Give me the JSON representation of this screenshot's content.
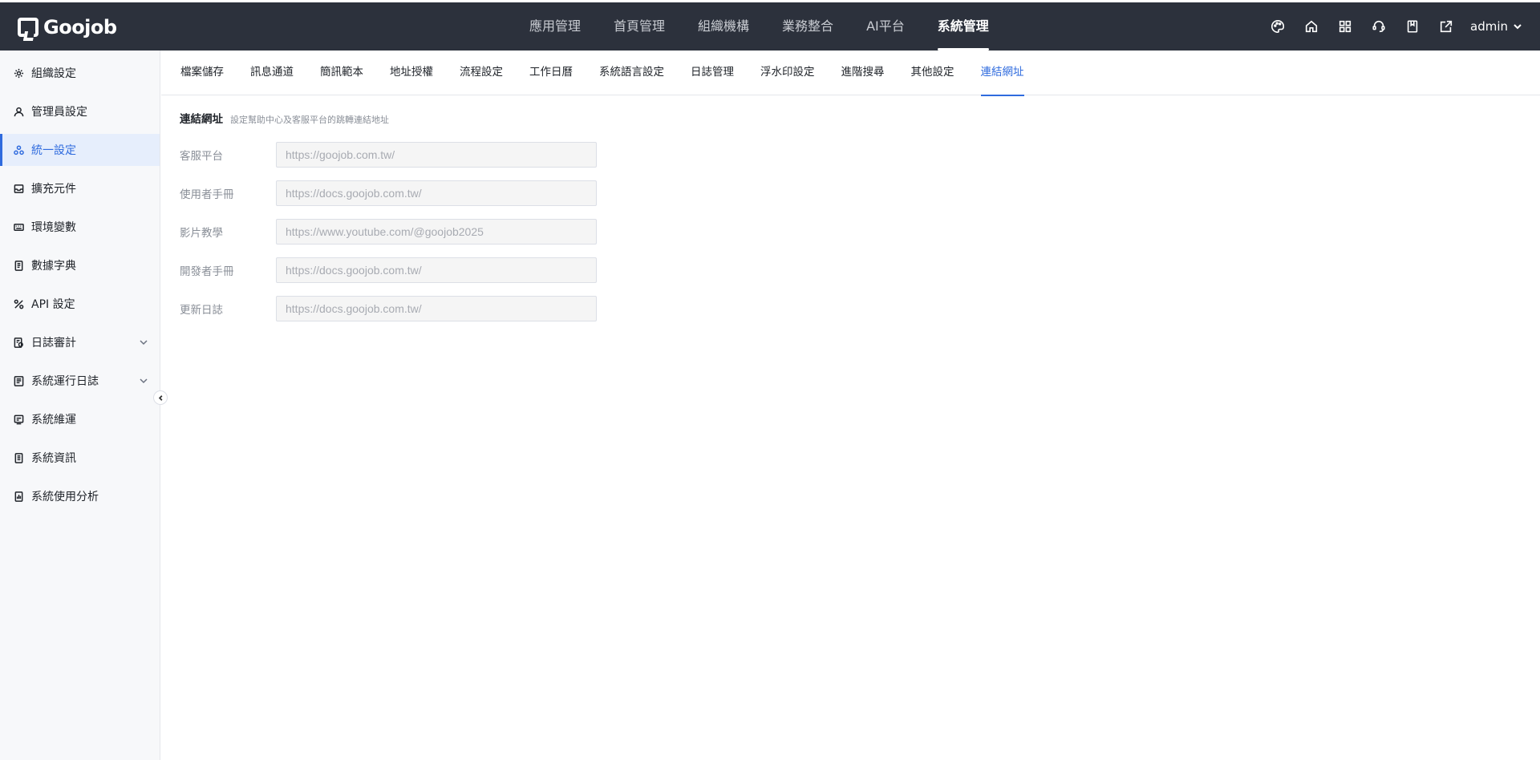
{
  "header": {
    "brand": "Goojob",
    "nav": [
      {
        "label": "應用管理"
      },
      {
        "label": "首頁管理"
      },
      {
        "label": "組織機構"
      },
      {
        "label": "業務整合"
      },
      {
        "label": "AI平台"
      },
      {
        "label": "系統管理",
        "active": true
      }
    ],
    "icons": [
      "palette-icon",
      "home-icon",
      "grid-icon",
      "support-icon",
      "book-icon",
      "export-icon"
    ],
    "user": "admin"
  },
  "sidebar": {
    "items": [
      {
        "label": "組織設定",
        "icon": "gear-icon"
      },
      {
        "label": "管理員設定",
        "icon": "user-icon"
      },
      {
        "label": "統一設定",
        "icon": "cluster-icon",
        "active": true
      },
      {
        "label": "擴充元件",
        "icon": "inbox-icon"
      },
      {
        "label": "環境變數",
        "icon": "keyboard-icon"
      },
      {
        "label": "數據字典",
        "icon": "document-icon"
      },
      {
        "label": "API 設定",
        "icon": "api-icon"
      },
      {
        "label": "日誌審計",
        "icon": "audit-icon",
        "expandable": true
      },
      {
        "label": "系統運行日誌",
        "icon": "log-icon",
        "expandable": true
      },
      {
        "label": "系統維運",
        "icon": "maintenance-icon"
      },
      {
        "label": "系統資訊",
        "icon": "info-doc-icon"
      },
      {
        "label": "系統使用分析",
        "icon": "analysis-icon"
      }
    ]
  },
  "subtabs": [
    {
      "label": "檔案儲存"
    },
    {
      "label": "訊息通道"
    },
    {
      "label": "簡訊範本"
    },
    {
      "label": "地址授權"
    },
    {
      "label": "流程設定"
    },
    {
      "label": "工作日曆"
    },
    {
      "label": "系統語言設定"
    },
    {
      "label": "日誌管理"
    },
    {
      "label": "浮水印設定"
    },
    {
      "label": "進階搜尋"
    },
    {
      "label": "其他設定"
    },
    {
      "label": "連結網址",
      "active": true
    }
  ],
  "section": {
    "title": "連結網址",
    "description": "設定幫助中心及客服平台的跳轉連結地址"
  },
  "fields": [
    {
      "label": "客服平台",
      "placeholder": "https://goojob.com.tw/"
    },
    {
      "label": "使用者手冊",
      "placeholder": "https://docs.goojob.com.tw/"
    },
    {
      "label": "影片教學",
      "placeholder": "https://www.youtube.com/@goojob2025"
    },
    {
      "label": "開發者手冊",
      "placeholder": "https://docs.goojob.com.tw/"
    },
    {
      "label": "更新日誌",
      "placeholder": "https://docs.goojob.com.tw/"
    }
  ]
}
